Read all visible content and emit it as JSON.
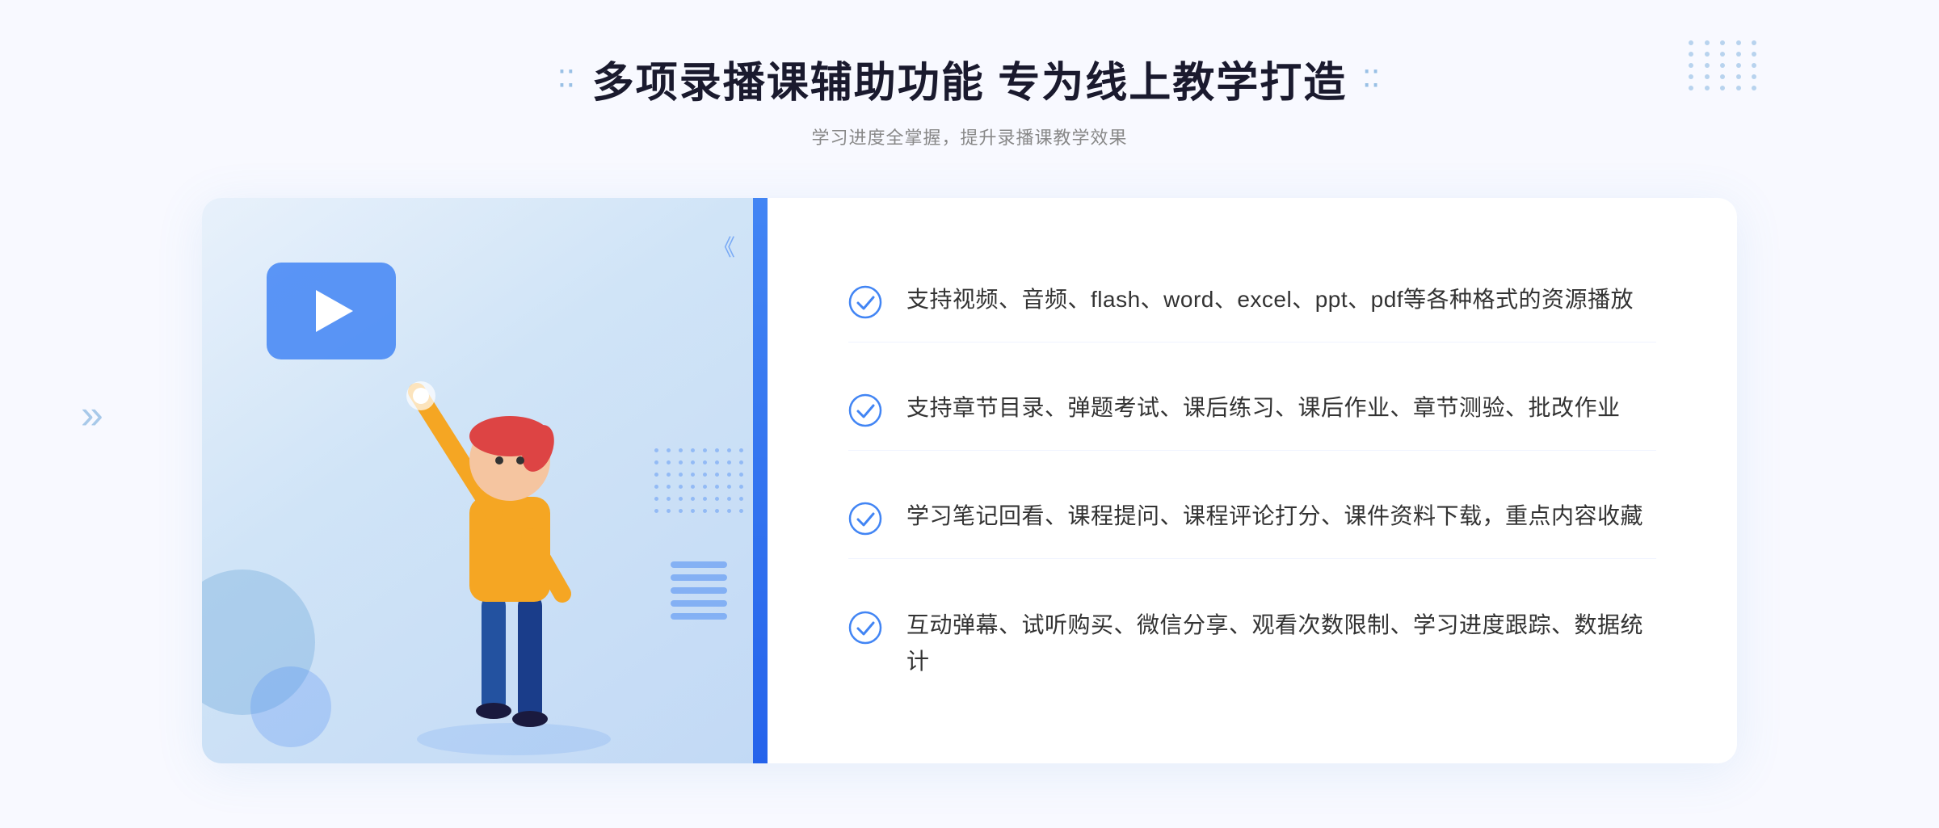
{
  "header": {
    "title": "多项录播课辅助功能 专为线上教学打造",
    "subtitle": "学习进度全掌握，提升录播课教学效果",
    "deco_left": "❮❮",
    "deco_right": "❯❯"
  },
  "features": [
    {
      "id": "feature-1",
      "text": "支持视频、音频、flash、word、excel、ppt、pdf等各种格式的资源播放"
    },
    {
      "id": "feature-2",
      "text": "支持章节目录、弹题考试、课后练习、课后作业、章节测验、批改作业"
    },
    {
      "id": "feature-3",
      "text": "学习笔记回看、课程提问、课程评论打分、课件资料下载，重点内容收藏"
    },
    {
      "id": "feature-4",
      "text": "互动弹幕、试听购买、微信分享、观看次数限制、学习进度跟踪、数据统计"
    }
  ],
  "colors": {
    "accent": "#4285f4",
    "accent_light": "#e8f1fb",
    "text_primary": "#1a1a2e",
    "text_secondary": "#888888",
    "check_color": "#4285f4"
  }
}
